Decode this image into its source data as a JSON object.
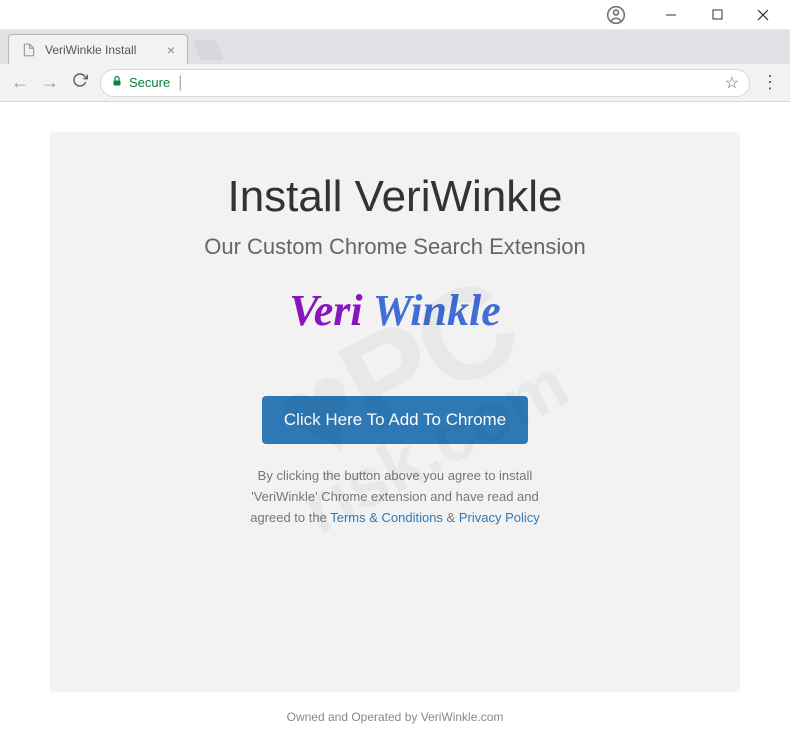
{
  "window": {
    "tab_title": "VeriWinkle Install"
  },
  "addressbar": {
    "secure_label": "Secure"
  },
  "page": {
    "title": "Install VeriWinkle",
    "subtitle": "Our Custom Chrome Search Extension",
    "logo_part1": "Veri ",
    "logo_part2": "Winkle",
    "button_label": "Click Here To Add To Chrome",
    "disclaimer_line1": "By clicking the button above you agree to install",
    "disclaimer_line2": "'VeriWinkle' Chrome extension and have read and",
    "disclaimer_line3_prefix": "agreed to the ",
    "terms_link": "Terms & Conditions",
    "amp": " & ",
    "privacy_link": "Privacy Policy",
    "footer_prefix": "Owned and Operated by ",
    "footer_site": "VeriWinkle.com"
  }
}
